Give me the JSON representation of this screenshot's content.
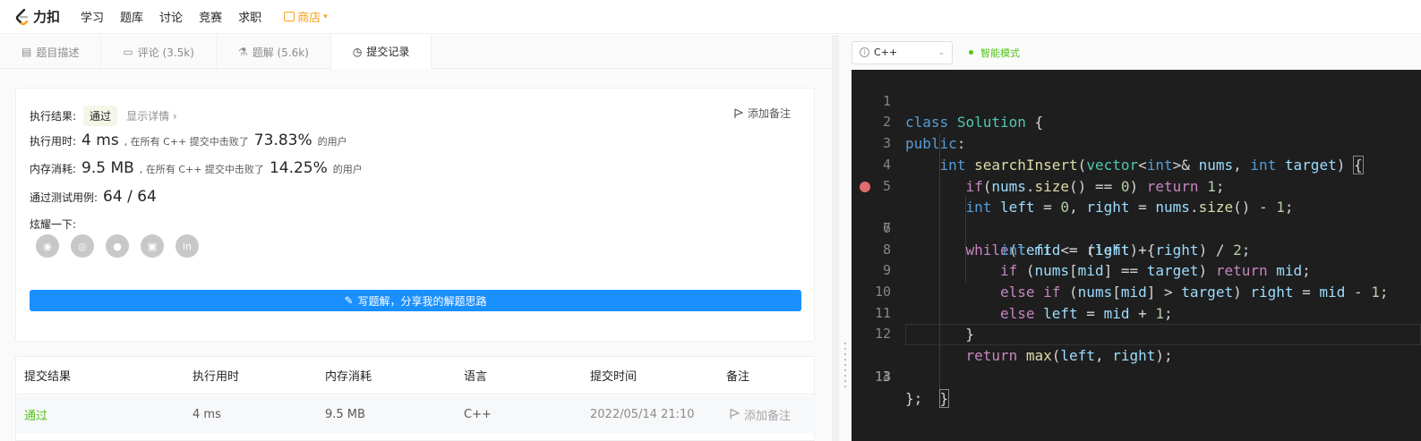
{
  "nav": {
    "logo_text": "力扣",
    "items": [
      "学习",
      "题库",
      "讨论",
      "竞赛",
      "求职"
    ],
    "shop": "商店"
  },
  "tabs": [
    {
      "label": "题目描述",
      "icon": "document-icon"
    },
    {
      "label": "评论 (3.5k)",
      "icon": "comment-icon"
    },
    {
      "label": "题解 (5.6k)",
      "icon": "flask-icon"
    },
    {
      "label": "提交记录",
      "icon": "clock-icon",
      "active": true
    }
  ],
  "result": {
    "label_status": "执行结果:",
    "status": "通过",
    "show_detail": "显示详情 ›",
    "add_note": "添加备注",
    "label_time": "执行用时:",
    "time_value": "4 ms",
    "time_mid": ", 在所有 C++ 提交中击败了",
    "time_percent": "73.83%",
    "time_suffix": "的用户",
    "label_mem": "内存消耗:",
    "mem_value": "9.5 MB",
    "mem_mid": ", 在所有 C++ 提交中击败了",
    "mem_percent": "14.25%",
    "mem_suffix": "的用户",
    "label_tests": "通过测试用例:",
    "tests_value": "64 / 64",
    "label_share": "炫耀一下:",
    "share_icons": [
      "wechat-icon",
      "weibo-icon",
      "qq-icon",
      "douban-icon",
      "linkedin-icon"
    ],
    "write_button": "写题解，分享我的解题思路"
  },
  "table": {
    "headers": [
      "提交结果",
      "执行用时",
      "内存消耗",
      "语言",
      "提交时间",
      "备注"
    ],
    "rows": [
      {
        "result": "通过",
        "time": "4 ms",
        "memory": "9.5 MB",
        "language": "C++",
        "submitted": "2022/05/14 21:10",
        "note": "添加备注"
      }
    ]
  },
  "editor": {
    "language": "C++",
    "mode": "智能模式",
    "accent_mode_color": "#52c41a",
    "line_numbers": [
      "1",
      "2",
      "3",
      "4",
      "5",
      "6",
      "7",
      "8",
      "9",
      "10",
      "11",
      "12",
      "13",
      "14"
    ],
    "breakpoint_line": 6,
    "current_line": 13
  },
  "colors": {
    "accent_blue": "#1a90ff",
    "pass_green": "#52c41a",
    "shop_orange": "#ffa116",
    "editor_bg": "#1e1e1e"
  }
}
